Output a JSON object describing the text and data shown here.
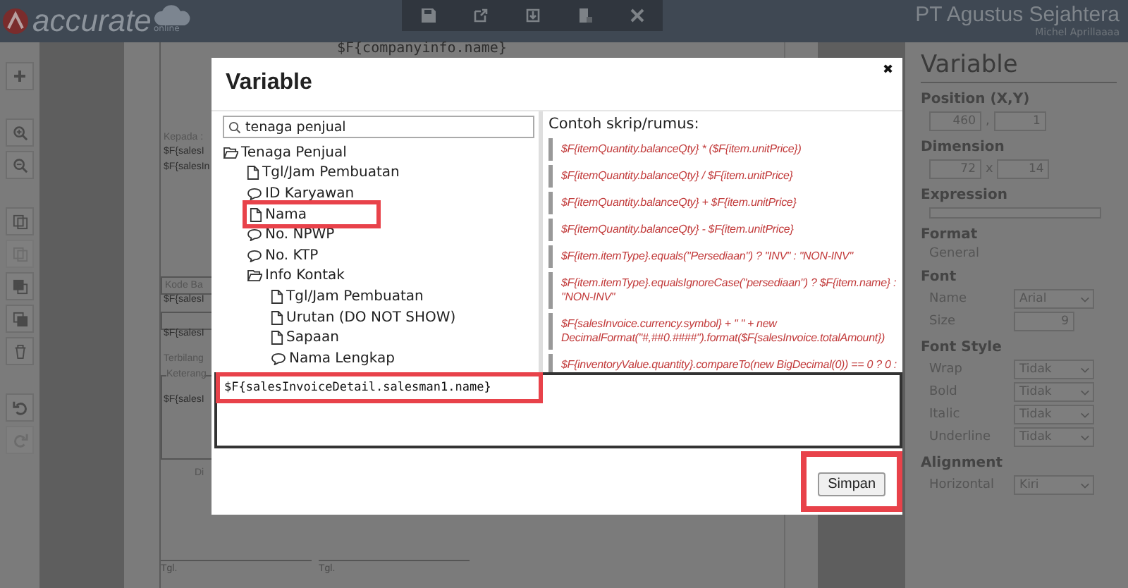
{
  "app_bar": {
    "logo": "accurate",
    "logo_sub": "online",
    "company": "PT Agustus Sejahtera",
    "user": "Michel Aprillaaaa"
  },
  "toolbar": [
    {
      "kind": "save"
    },
    {
      "kind": "export"
    },
    {
      "kind": "import"
    },
    {
      "kind": "document"
    },
    {
      "kind": "close"
    }
  ],
  "tools": [
    {
      "kind": "add",
      "disabled": false
    },
    {
      "kind": "zoom-in",
      "disabled": false
    },
    {
      "kind": "zoom-out",
      "disabled": false
    },
    {
      "kind": "copy",
      "disabled": false
    },
    {
      "kind": "paste",
      "disabled": true
    },
    {
      "kind": "front",
      "disabled": false
    },
    {
      "kind": "back",
      "disabled": false
    },
    {
      "kind": "delete",
      "disabled": false
    },
    {
      "kind": "undo",
      "disabled": false
    },
    {
      "kind": "redo",
      "disabled": true
    }
  ],
  "report": {
    "header": "$F{companyinfo.name}",
    "items": [
      {
        "kind": "label",
        "text": "Kepada :"
      },
      {
        "kind": "text",
        "text": "$F{salesI"
      },
      {
        "kind": "text",
        "text": "$F{salesIn"
      },
      {
        "kind": "boxed",
        "text": "Kode Ba"
      },
      {
        "kind": "text",
        "text": "$F{salesI"
      },
      {
        "kind": "box"
      },
      {
        "kind": "text",
        "text": "$F{salesI"
      },
      {
        "kind": "label",
        "text": "Terbilang"
      },
      {
        "kind": "legend",
        "text": "Keterang"
      },
      {
        "kind": "text",
        "text": "$F{salesI"
      },
      {
        "kind": "label",
        "text": "Di"
      },
      {
        "kind": "signature",
        "text": "Tgl."
      },
      {
        "kind": "signature",
        "text": "Tgl."
      }
    ]
  },
  "properties": {
    "title": "Variable",
    "sections": [
      {
        "title": "Position (X,Y)",
        "rows": [
          {
            "kind": "pair",
            "a": "460",
            "sep": ",",
            "b": "1"
          }
        ]
      },
      {
        "title": "Dimension",
        "rows": [
          {
            "kind": "pair",
            "a": "72",
            "sep": "x",
            "b": "14"
          }
        ]
      },
      {
        "title": "Expression",
        "rows": [
          {
            "kind": "field"
          }
        ]
      },
      {
        "title": "Format",
        "rows": [
          {
            "kind": "text",
            "value": "General"
          }
        ]
      },
      {
        "title": "Font",
        "rows": [
          {
            "kind": "select",
            "label": "Name",
            "value": "Arial"
          },
          {
            "kind": "number",
            "label": "Size",
            "value": "9"
          }
        ]
      },
      {
        "title": "Font Style",
        "rows": [
          {
            "kind": "select",
            "label": "Wrap",
            "value": "Tidak"
          },
          {
            "kind": "select",
            "label": "Bold",
            "value": "Tidak"
          },
          {
            "kind": "select",
            "label": "Italic",
            "value": "Tidak"
          },
          {
            "kind": "select",
            "label": "Underline",
            "value": "Tidak"
          }
        ]
      },
      {
        "title": "Alignment",
        "rows": [
          {
            "kind": "select",
            "label": "Horizontal",
            "value": "Kiri"
          }
        ]
      }
    ]
  },
  "dialog": {
    "title": "Variable",
    "close": "✖",
    "search": {
      "value": "tenaga penjual"
    },
    "tree": [
      {
        "kind": "folder",
        "label": "Tenaga Penjual",
        "highlighted": false,
        "children": [
          {
            "kind": "file",
            "label": "Tgl/Jam Pembuatan",
            "highlighted": false
          },
          {
            "kind": "comment",
            "label": "ID Karyawan",
            "highlighted": false
          },
          {
            "kind": "file",
            "label": "Nama",
            "highlighted": true
          },
          {
            "kind": "comment",
            "label": "No. NPWP",
            "highlighted": false
          },
          {
            "kind": "comment",
            "label": "No. KTP",
            "highlighted": false
          },
          {
            "kind": "folder",
            "label": "Info Kontak",
            "highlighted": false,
            "children": [
              {
                "kind": "file",
                "label": "Tgl/Jam Pembuatan",
                "highlighted": false
              },
              {
                "kind": "file",
                "label": "Urutan (DO NOT SHOW)",
                "highlighted": false
              },
              {
                "kind": "file",
                "label": "Sapaan",
                "highlighted": false
              },
              {
                "kind": "comment",
                "label": "Nama Lengkap",
                "highlighted": false
              }
            ]
          }
        ]
      }
    ],
    "examples_title": "Contoh skrip/rumus:",
    "examples": [
      "$F{itemQuantity.balanceQty} * ($F{item.unitPrice})",
      "$F{itemQuantity.balanceQty} / $F{item.unitPrice}",
      "$F{itemQuantity.balanceQty} + $F{item.unitPrice}",
      "$F{itemQuantity.balanceQty} - $F{item.unitPrice}",
      "$F{item.itemType}.equals(\"Persediaan\") ? \"INV\" : \"NON-INV\"",
      "$F{item.itemType}.equalsIgnoreCase(\"persediaan\") ? $F{item.name} : \"NON-INV\"",
      "$F{salesInvoice.currency.symbol} + \" \" + new DecimalFormat(\"#,##0.####\").format($F{salesInvoice.totalAmount})",
      "$F{inventoryValue.quantity}.compareTo(new BigDecimal(0)) == 0 ? 0 :"
    ],
    "expression": {
      "value": "$F{salesInvoiceDetail.salesman1.name}",
      "highlighted": true
    },
    "save": {
      "label": "Simpan",
      "highlighted": true
    }
  }
}
